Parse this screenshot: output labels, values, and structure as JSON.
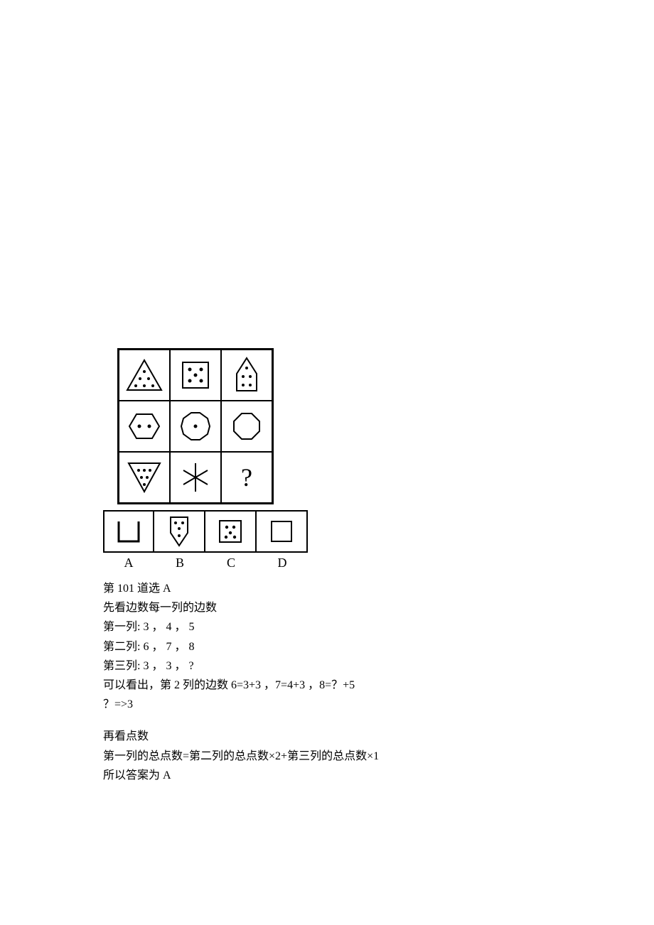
{
  "options": {
    "A": "A",
    "B": "B",
    "C": "C",
    "D": "D"
  },
  "lines": {
    "l1": "第 101 道选 A",
    "l2": "先看边数每一列的边数",
    "l3": "第一列: 3 ， 4 ， 5",
    "l4": "第二列: 6 ， 7 ， 8",
    "l5": "第三列: 3 ， 3 ， ?",
    "l6": "可以看出，第 2 列的边数 6=3+3 ，7=4+3 ，8=？+5",
    "l7": "？=>3",
    "l8": "再看点数",
    "l9": "第一列的总点数=第二列的总点数×2+第三列的总点数×1",
    "l10": "所以答案为 A"
  },
  "question_mark": "?"
}
